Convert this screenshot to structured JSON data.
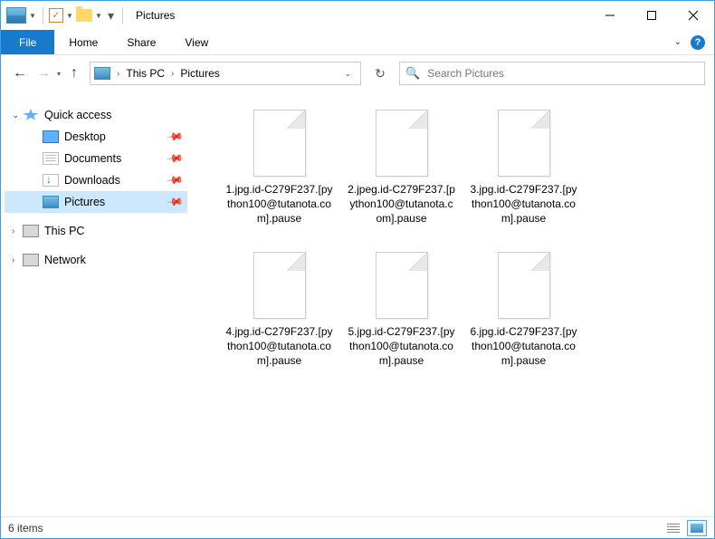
{
  "titlebar": {
    "title": "Pictures"
  },
  "ribbon": {
    "file": "File",
    "tabs": [
      "Home",
      "Share",
      "View"
    ]
  },
  "breadcrumbs": [
    "This PC",
    "Pictures"
  ],
  "search": {
    "placeholder": "Search Pictures"
  },
  "sidebar": {
    "quick_access": "Quick access",
    "items": [
      {
        "label": "Desktop"
      },
      {
        "label": "Documents"
      },
      {
        "label": "Downloads"
      },
      {
        "label": "Pictures"
      }
    ],
    "this_pc": "This PC",
    "network": "Network"
  },
  "files": [
    {
      "name": "1.jpg.id-C279F237.[python100@tutanota.com].pause"
    },
    {
      "name": "2.jpeg.id-C279F237.[python100@tutanota.com].pause"
    },
    {
      "name": "3.jpg.id-C279F237.[python100@tutanota.com].pause"
    },
    {
      "name": "4.jpg.id-C279F237.[python100@tutanota.com].pause"
    },
    {
      "name": "5.jpg.id-C279F237.[python100@tutanota.com].pause"
    },
    {
      "name": "6.jpg.id-C279F237.[python100@tutanota.com].pause"
    }
  ],
  "status": {
    "count": "6 items"
  }
}
